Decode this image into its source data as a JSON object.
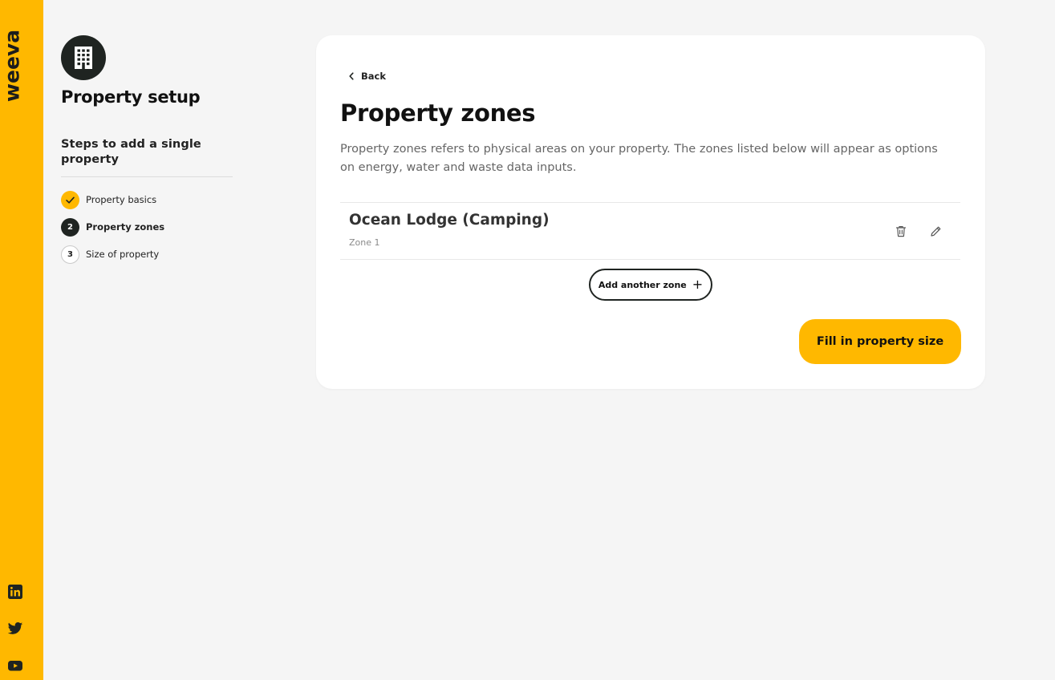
{
  "brand": {
    "logo_text": "weeva",
    "accent_color": "#ffb800",
    "social_links": [
      {
        "name": "linkedin-icon"
      },
      {
        "name": "twitter-icon"
      },
      {
        "name": "youtube-icon"
      }
    ]
  },
  "sidebar": {
    "icon": "building-icon",
    "title": "Property setup",
    "steps_heading": "Steps to add a single property",
    "steps": [
      {
        "marker": "",
        "label": "Property basics",
        "status": "completed"
      },
      {
        "marker": "2",
        "label": "Property zones",
        "status": "active"
      },
      {
        "marker": "3",
        "label": "Size of property",
        "status": "pending"
      }
    ]
  },
  "main": {
    "back_label": "Back",
    "title": "Property zones",
    "description": "Property zones refers to physical areas on your property. The zones listed below will appear as options on energy, water and waste data inputs.",
    "zones": [
      {
        "name": "Ocean Lodge (Camping)",
        "subtitle": "Zone 1"
      }
    ],
    "add_zone_label": "Add another zone",
    "add_zone_icon": "+",
    "primary_button_label": "Fill in property size"
  }
}
